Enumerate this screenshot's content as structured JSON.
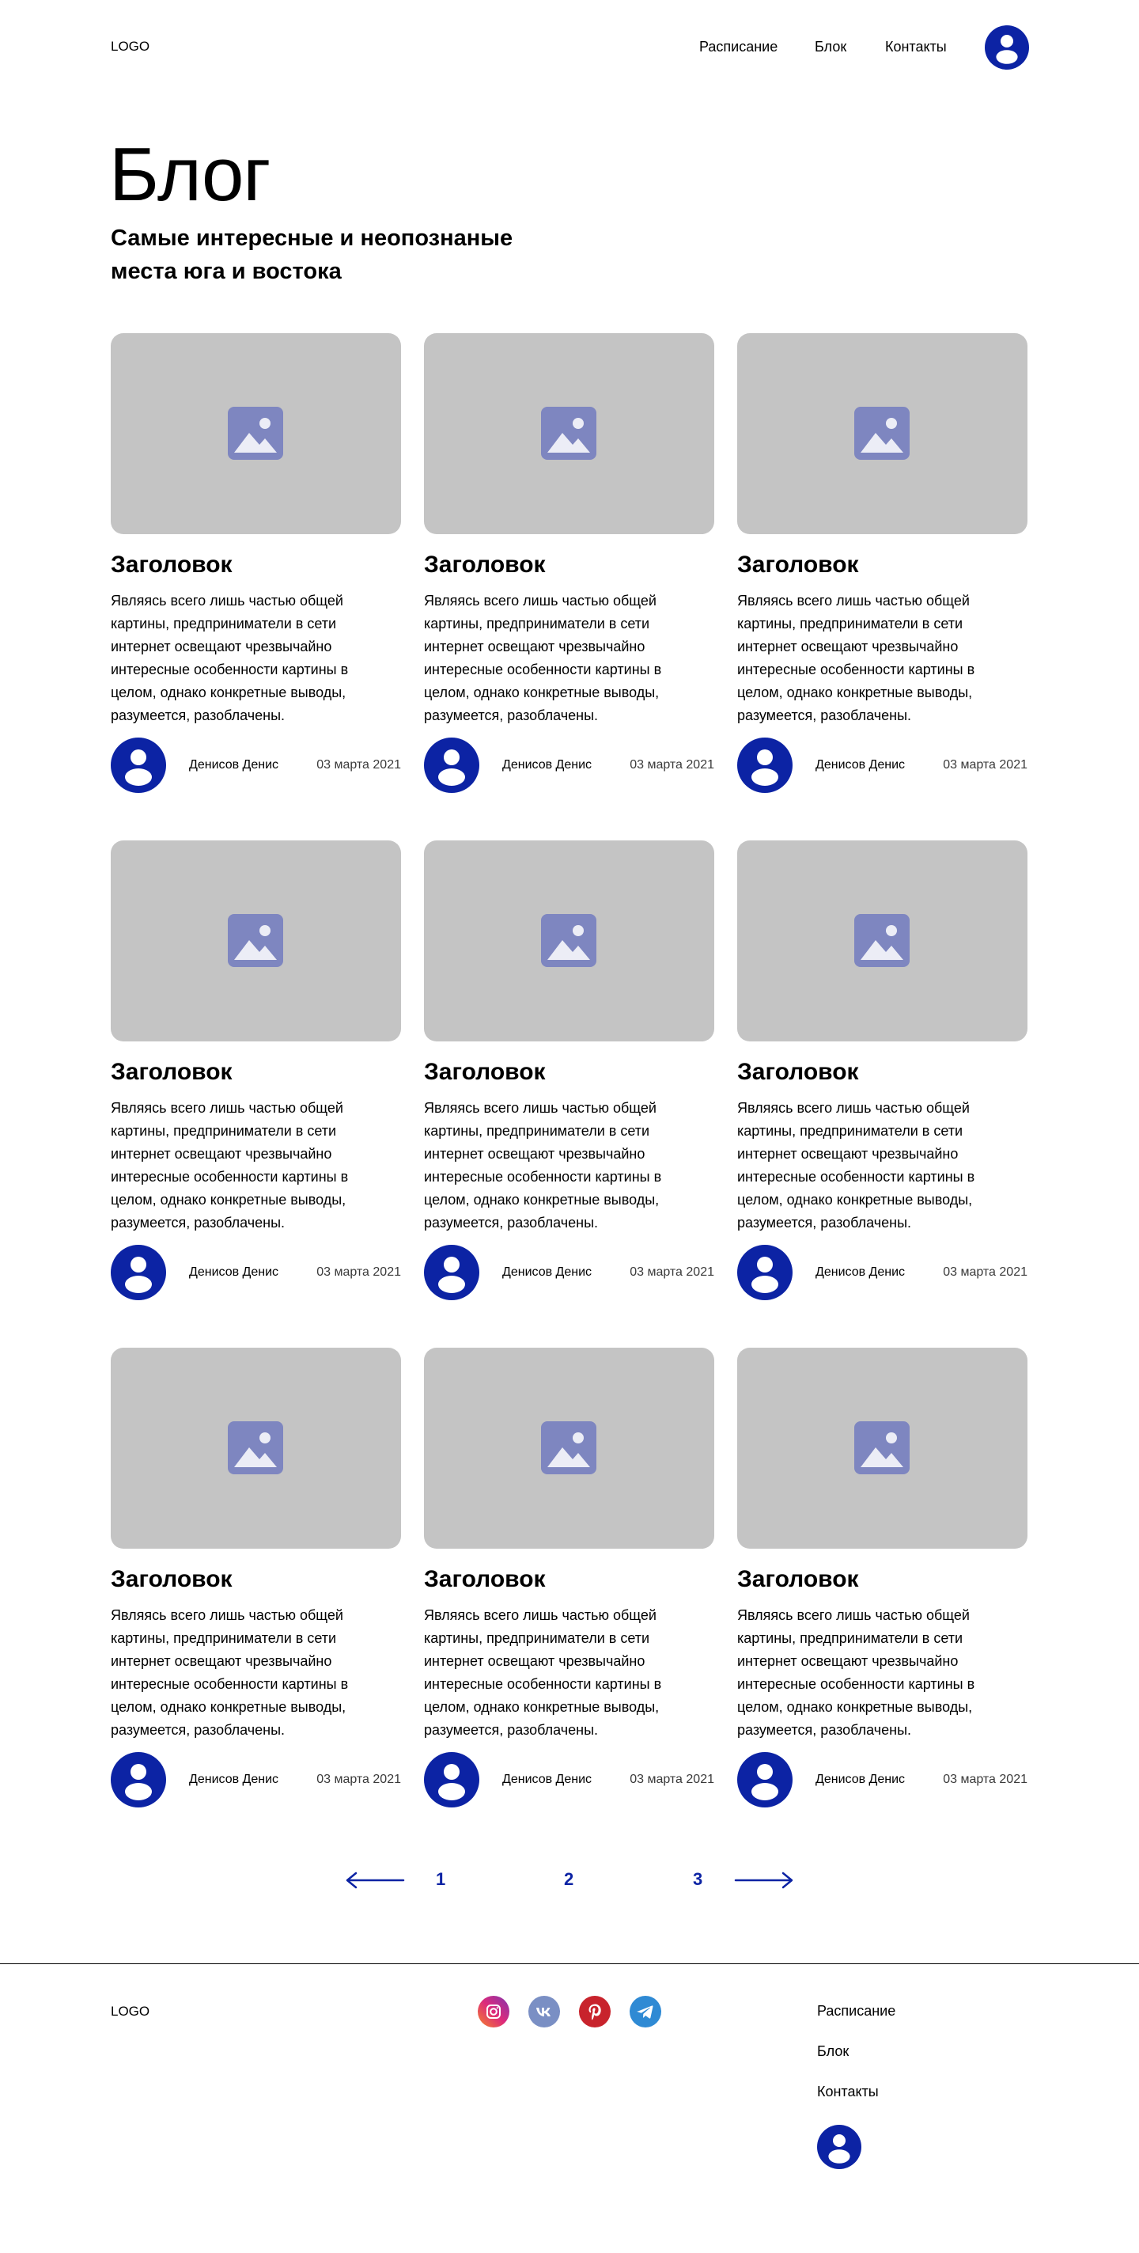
{
  "header": {
    "logo": "LOGO",
    "nav": [
      "Расписание",
      "Блок",
      "Контакты"
    ]
  },
  "hero": {
    "title": "Блог",
    "subtitle_line1": "Самые интересные и неопознаные",
    "subtitle_line2": "места юга и востока"
  },
  "posts": [
    {
      "title": "Заголовок",
      "text": "Являясь всего лишь частью общей картины, предприниматели в сети интернет освещают чрезвычайно интересные особенности картины в целом, однако конкретные выводы, разумеется, разоблачены.",
      "author": "Денисов Денис",
      "date": "03 марта 2021"
    },
    {
      "title": "Заголовок",
      "text": "Являясь всего лишь частью общей картины, предприниматели в сети интернет освещают чрезвычайно интересные особенности картины в целом, однако конкретные выводы, разумеется, разоблачены.",
      "author": "Денисов Денис",
      "date": "03 марта 2021"
    },
    {
      "title": "Заголовок",
      "text": "Являясь всего лишь частью общей картины, предприниматели в сети интернет освещают чрезвычайно интересные особенности картины в целом, однако конкретные выводы, разумеется, разоблачены.",
      "author": "Денисов Денис",
      "date": "03 марта 2021"
    },
    {
      "title": "Заголовок",
      "text": "Являясь всего лишь частью общей картины, предприниматели в сети интернет освещают чрезвычайно интересные особенности картины в целом, однако конкретные выводы, разумеется, разоблачены.",
      "author": "Денисов Денис",
      "date": "03 марта 2021"
    },
    {
      "title": "Заголовок",
      "text": "Являясь всего лишь частью общей картины, предприниматели в сети интернет освещают чрезвычайно интересные особенности картины в целом, однако конкретные выводы, разумеется, разоблачены.",
      "author": "Денисов Денис",
      "date": "03 марта 2021"
    },
    {
      "title": "Заголовок",
      "text": "Являясь всего лишь частью общей картины, предприниматели в сети интернет освещают чрезвычайно интересные особенности картины в целом, однако конкретные выводы, разумеется, разоблачены.",
      "author": "Денисов Денис",
      "date": "03 марта 2021"
    },
    {
      "title": "Заголовок",
      "text": "Являясь всего лишь частью общей картины, предприниматели в сети интернет освещают чрезвычайно интересные особенности картины в целом, однако конкретные выводы, разумеется, разоблачены.",
      "author": "Денисов Денис",
      "date": "03 марта 2021"
    },
    {
      "title": "Заголовок",
      "text": "Являясь всего лишь частью общей картины, предприниматели в сети интернет освещают чрезвычайно интересные особенности картины в целом, однако конкретные выводы, разумеется, разоблачены.",
      "author": "Денисов Денис",
      "date": "03 марта 2021"
    },
    {
      "title": "Заголовок",
      "text": "Являясь всего лишь частью общей картины, предприниматели в сети интернет освещают чрезвычайно интересные особенности картины в целом, однако конкретные выводы, разумеется, разоблачены.",
      "author": "Денисов Денис",
      "date": "03 марта 2021"
    }
  ],
  "pagination": {
    "pages": [
      "1",
      "2",
      "3"
    ],
    "prev_icon": "arrow-left-icon",
    "next_icon": "arrow-right-icon"
  },
  "footer": {
    "logo": "LOGO",
    "social": [
      "instagram-icon",
      "vk-icon",
      "pinterest-icon",
      "telegram-icon"
    ],
    "nav": [
      "Расписание",
      "Блок",
      "Контакты"
    ]
  },
  "colors": {
    "accent": "#0c23a4",
    "placeholder": "#c4c4c4",
    "image_icon": "#7e86c0",
    "instagram": "#e1306c",
    "vk": "#7a8fc4",
    "pinterest": "#c8232c",
    "telegram": "#2f8ad4"
  }
}
